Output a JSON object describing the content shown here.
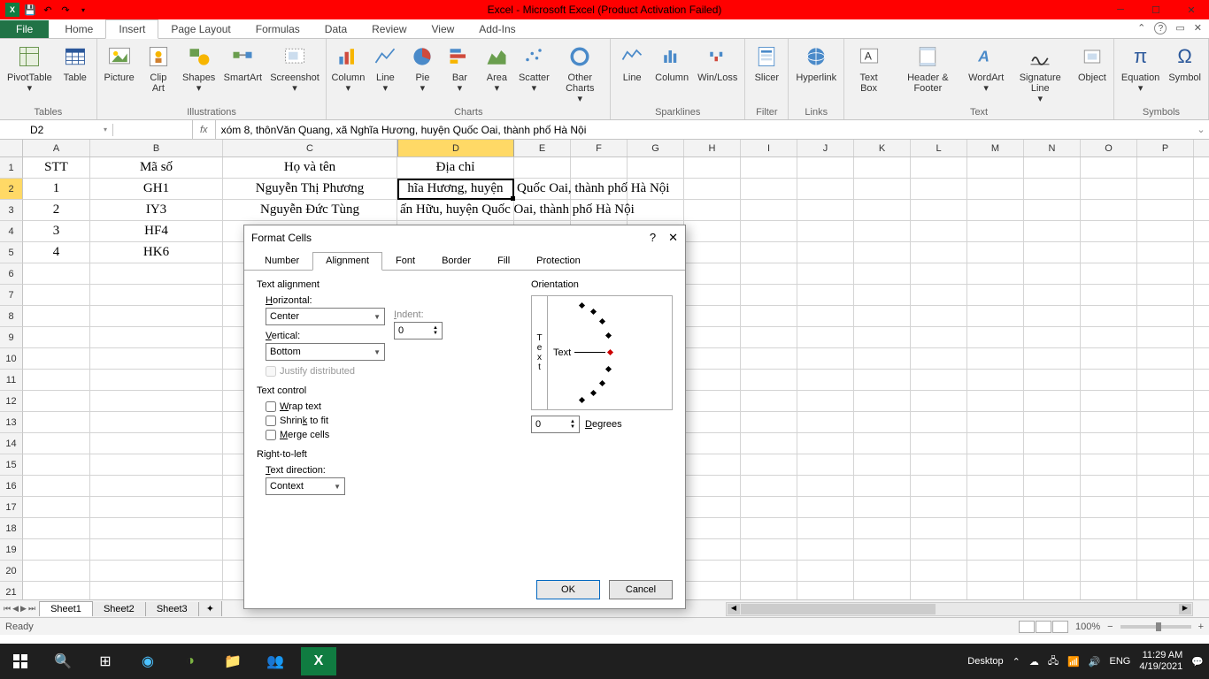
{
  "titlebar": {
    "title": "Excel  -  Microsoft Excel (Product Activation Failed)"
  },
  "ribbon_tabs": {
    "file": "File",
    "home": "Home",
    "insert": "Insert",
    "page_layout": "Page Layout",
    "formulas": "Formulas",
    "data": "Data",
    "review": "Review",
    "view": "View",
    "addins": "Add-Ins"
  },
  "ribbon": {
    "tables": {
      "label": "Tables",
      "pivot": "PivotTable",
      "table": "Table"
    },
    "illustrations": {
      "label": "Illustrations",
      "picture": "Picture",
      "clipart": "Clip Art",
      "shapes": "Shapes",
      "smartart": "SmartArt",
      "screenshot": "Screenshot"
    },
    "charts": {
      "label": "Charts",
      "column": "Column",
      "line": "Line",
      "pie": "Pie",
      "bar": "Bar",
      "area": "Area",
      "scatter": "Scatter",
      "other": "Other Charts"
    },
    "sparklines": {
      "label": "Sparklines",
      "line": "Line",
      "column": "Column",
      "winloss": "Win/Loss"
    },
    "filter": {
      "label": "Filter",
      "slicer": "Slicer"
    },
    "links": {
      "label": "Links",
      "hyperlink": "Hyperlink"
    },
    "text": {
      "label": "Text",
      "textbox": "Text Box",
      "headerfooter": "Header & Footer",
      "wordart": "WordArt",
      "sigline": "Signature Line",
      "object": "Object"
    },
    "symbols": {
      "label": "Symbols",
      "equation": "Equation",
      "symbol": "Symbol"
    }
  },
  "namebox": "D2",
  "fx": "fx",
  "formula": "xóm 8, thônVăn Quang, xã Nghĩa Hương, huyện Quốc Oai, thành phố Hà Nội",
  "columns": [
    "A",
    "B",
    "C",
    "D",
    "E",
    "F",
    "G",
    "H",
    "I",
    "J",
    "K",
    "L",
    "M",
    "N",
    "O",
    "P"
  ],
  "rows": [
    "1",
    "2",
    "3",
    "4",
    "5",
    "6",
    "7",
    "8",
    "9",
    "10",
    "11",
    "12",
    "13",
    "14",
    "15",
    "16",
    "17",
    "18",
    "19",
    "20",
    "21"
  ],
  "cells": {
    "A1": "STT",
    "B1": "Mã số",
    "C1": "Họ và tên",
    "D1": "Địa chỉ",
    "A2": "1",
    "B2": "GH1",
    "C2": "Nguyễn Thị Phương",
    "D2": "hĩa Hương, huyện",
    "A3": "2",
    "B3": "IY3",
    "C3": "Nguyễn Đức Tùng",
    "A4": "3",
    "B4": "HF4",
    "A5": "4",
    "B5": "HK6"
  },
  "overflow": {
    "row2": "Quốc Oai, thành phố Hà Nội",
    "row3": "ấn Hữu, huyện Quốc Oai, thành phố Hà Nội"
  },
  "sheets": {
    "s1": "Sheet1",
    "s2": "Sheet2",
    "s3": "Sheet3"
  },
  "status": {
    "ready": "Ready",
    "zoom": "100%"
  },
  "dialog": {
    "title": "Format Cells",
    "tabs": {
      "number": "Number",
      "alignment": "Alignment",
      "font": "Font",
      "border": "Border",
      "fill": "Fill",
      "protection": "Protection"
    },
    "text_alignment": "Text alignment",
    "horizontal": "Horizontal:",
    "h_val": "Center",
    "vertical": "Vertical:",
    "v_val": "Bottom",
    "indent": "Indent:",
    "indent_val": "0",
    "justify": "Justify distributed",
    "text_control": "Text control",
    "wrap": "Wrap text",
    "shrink": "Shrink to fit",
    "merge": "Merge cells",
    "rtl": "Right-to-left",
    "text_dir": "Text direction:",
    "dir_val": "Context",
    "orientation": "Orientation",
    "orient_text": "Text",
    "degrees": "Degrees",
    "deg_val": "0",
    "ok": "OK",
    "cancel": "Cancel"
  },
  "taskbar": {
    "desktop": "Desktop",
    "lang": "ENG",
    "time": "11:29 AM",
    "date": "4/19/2021"
  }
}
